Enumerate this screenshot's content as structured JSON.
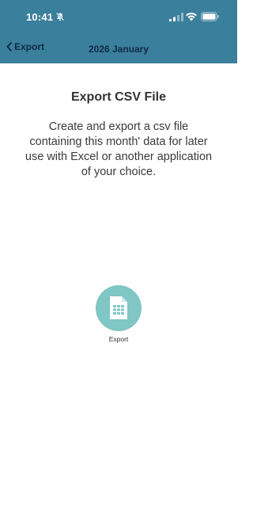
{
  "status_bar": {
    "time": "10:41",
    "icons": [
      "bell-off-icon",
      "signal-icon",
      "wifi-icon",
      "battery-icon"
    ]
  },
  "nav": {
    "back_label": "Export",
    "title": "2026 January"
  },
  "content": {
    "title": "Export CSV File",
    "description": "Create and export a csv file containing this month' data for later use with Excel or another application of your choice."
  },
  "export_action": {
    "icon": "csv-file-icon",
    "label": "Export"
  },
  "colors": {
    "header_bg": "#3a7f9c",
    "header_text": "#0e2a45",
    "accent": "#7fc6c4"
  }
}
